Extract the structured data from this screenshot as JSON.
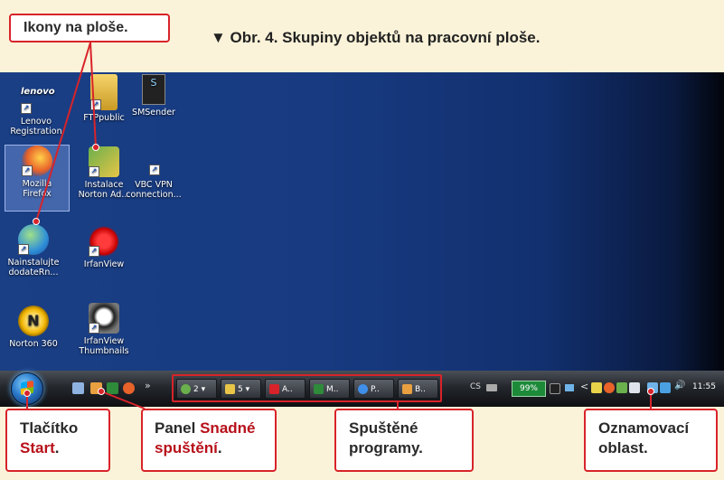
{
  "caption": "▼ Obr. 4. Skupiny objektů na pracovní ploše.",
  "callouts": {
    "desktop_icons": "Ikony na ploše.",
    "start_line1": "Tlačítko",
    "start_line2": "Start",
    "start_suffix": ".",
    "quicklaunch_prefix": "Panel ",
    "quicklaunch_hl1": "Snadné",
    "quicklaunch_hl2": "spuštění",
    "quicklaunch_suffix": ".",
    "running_line1": "Spuštěné",
    "running_line2": "programy.",
    "tray_line1": "Oznamovací",
    "tray_line2": "oblast."
  },
  "desktop": {
    "icons": [
      {
        "line1": "Lenovo",
        "line2": "Registration",
        "icon": "lenovo-icon"
      },
      {
        "line1": "FTPpublic",
        "line2": "",
        "icon": "folder-icon"
      },
      {
        "line1": "SMSender",
        "line2": "",
        "icon": "smsender-icon"
      },
      {
        "line1": "Mozilla",
        "line2": "Firefox",
        "icon": "firefox-icon"
      },
      {
        "line1": "Instalace",
        "line2": "Norton Ad...",
        "icon": "norton-install-icon"
      },
      {
        "line1": "VBC VPN",
        "line2": "connection...",
        "icon": "vpn-icon"
      },
      {
        "line1": "Nainstalujte",
        "line2": "dodateRn...",
        "icon": "globe-install-icon"
      },
      {
        "line1": "IrfanView",
        "line2": "",
        "icon": "irfanview-icon"
      },
      {
        "line1": "Norton 360",
        "line2": "",
        "icon": "norton360-icon"
      },
      {
        "line1": "IrfanView",
        "line2": "Thumbnails",
        "icon": "panda-icon"
      }
    ]
  },
  "taskbar": {
    "buttons": [
      {
        "label": "2 ▾",
        "icon": "group-icon"
      },
      {
        "label": "5 ▾",
        "icon": "folder-group-icon"
      },
      {
        "label": "A..",
        "icon": "pdf-icon"
      },
      {
        "label": "M..",
        "icon": "excel-icon"
      },
      {
        "label": "P..",
        "icon": "ie-icon"
      },
      {
        "label": "B..",
        "icon": "app-icon"
      }
    ],
    "lang": "CS",
    "battery": "99%",
    "clock": "11:55",
    "chevron": "»",
    "tray_chevron": "<"
  },
  "colors": {
    "accent": "#d8232a",
    "desktop": "#173a80",
    "background": "#fbf3d9"
  }
}
